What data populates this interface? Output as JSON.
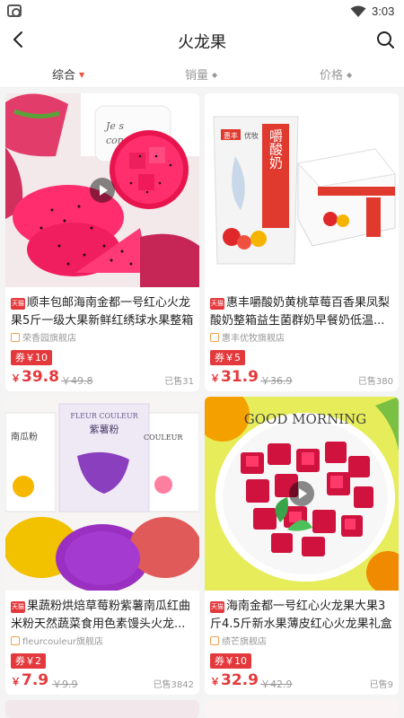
{
  "status": {
    "time": "3:03"
  },
  "header": {
    "title": "火龙果"
  },
  "sort": [
    {
      "label": "综合",
      "active": true
    },
    {
      "label": "销量",
      "active": false
    },
    {
      "label": "价格",
      "active": false
    }
  ],
  "products": [
    {
      "title": "顺丰包邮海南金都一号红心火龙果5斤一级大果新鲜红绣球水果整箱",
      "badge": "天猫",
      "shop": "荣香园旗舰店",
      "coupon": "券￥10",
      "price": "39.8",
      "original_price": "￥49.8",
      "sold": "已售31",
      "has_video": true,
      "image_text": [
        "Je s",
        "con"
      ]
    },
    {
      "title": "惠丰嚼酸奶黄桃草莓百香果凤梨酸奶整箱益生菌群奶早餐奶低温...",
      "badge": "天猫",
      "shop": "惠丰优牧旗舰店",
      "coupon": "券￥5",
      "price": "31.9",
      "original_price": "￥36.9",
      "sold": "已售380",
      "has_video": false,
      "image_text": [
        "嚼酸奶",
        "惠丰",
        "优牧"
      ]
    },
    {
      "title": "果蔬粉烘焙草莓粉紫薯南瓜红曲米粉天然蔬菜食用色素馒头火龙...",
      "badge": "天猫",
      "shop": "fleurcouleur旗舰店",
      "coupon": "券￥2",
      "price": "7.9",
      "original_price": "￥9.9",
      "sold": "已售3842",
      "has_video": false,
      "image_text": [
        "FLEUR COULEUR",
        "紫薯粉",
        "南瓜粉",
        "COULEUR"
      ]
    },
    {
      "title": "海南金都一号红心火龙果大果3斤4.5斤新水果薄皮红心火龙果礼盒",
      "badge": "天猫",
      "shop": "绩芒旗舰店",
      "coupon": "券￥10",
      "price": "32.9",
      "original_price": "￥42.9",
      "sold": "已售9",
      "has_video": true,
      "image_text": [
        "GOOD MORNING"
      ]
    }
  ],
  "colors": {
    "accent": "#e4393c",
    "sort_arrow": "#f0533f"
  }
}
